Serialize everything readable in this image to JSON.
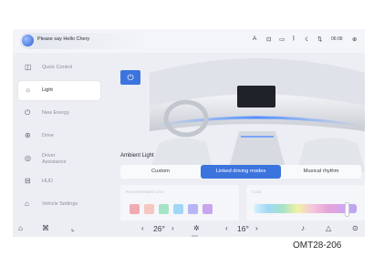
{
  "voice": {
    "prompt": "Please say Hello Chery"
  },
  "status": {
    "icons": [
      "A",
      "⊡",
      "▭",
      "ᛒ",
      "☇",
      "⇅"
    ],
    "time": "06:06",
    "settings_icon": "⊕"
  },
  "sidebar": {
    "items": [
      {
        "icon": "◫",
        "label": "Quick Control"
      },
      {
        "icon": "☼",
        "label": "Light"
      },
      {
        "icon": "⏻",
        "label": "New Energy"
      },
      {
        "icon": "⊛",
        "label": "Drive"
      },
      {
        "icon": "◎",
        "label": "Driver\nAssistance"
      },
      {
        "icon": "⊟",
        "label": "HUD"
      },
      {
        "icon": "⌂",
        "label": "Vehicle Settings"
      }
    ],
    "active_index": 1
  },
  "power": {
    "icon": "⏻"
  },
  "ambient": {
    "title": "Ambient Light",
    "modes": [
      "Custom",
      "Linked driving modes",
      "Musical rhythm"
    ],
    "active_mode": 1,
    "recommended_label": "Recommended color",
    "swatches": [
      "#f1a9b3",
      "#f4c7c0",
      "#a6e3c5",
      "#9fd8f5",
      "#b7b6f5",
      "#c8a6ee"
    ],
    "color_label": "Color",
    "color_position": 0.9
  },
  "bottom": {
    "home_icon": "⌂",
    "apps_icon": "⌘",
    "seat_icon": "⌞",
    "left_temp": "26°",
    "left_temp_arrows": [
      "‹",
      "›"
    ],
    "fan_icon": "✲",
    "fan_label": "auto",
    "right_temp": "16°",
    "right_temp_arrows": [
      "‹",
      "›"
    ],
    "seat_heat_icon": "♪",
    "warning_icon": "△",
    "steering_icon": "⊙"
  },
  "caption": "OMT28-206"
}
